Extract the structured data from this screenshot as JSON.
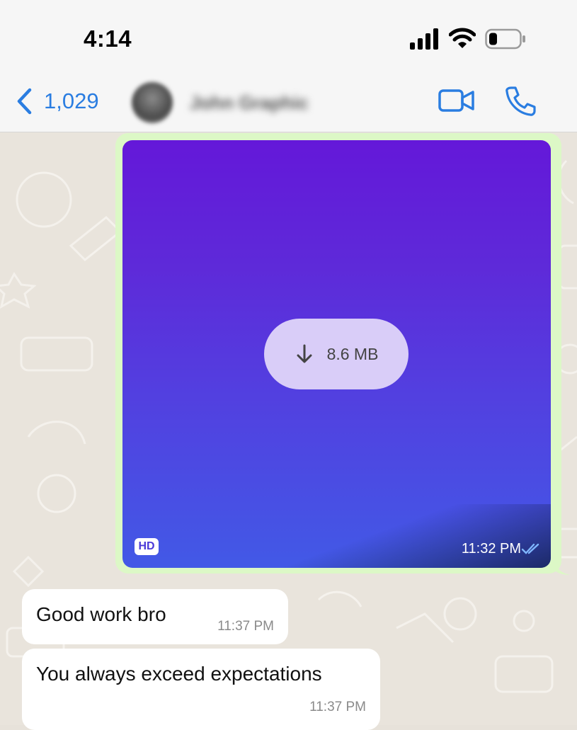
{
  "status_bar": {
    "time": "4:14"
  },
  "header": {
    "back_count": "1,029",
    "contact_name": "John Graphic"
  },
  "messages": {
    "image": {
      "download_size": "8.6 MB",
      "hd_label": "HD",
      "time": "11:32 PM"
    },
    "text": [
      {
        "text": "Good work bro",
        "time": "11:37 PM"
      },
      {
        "text": "You always exceed expectations",
        "time": "11:37 PM"
      }
    ]
  },
  "colors": {
    "accent": "#2a7de1",
    "outgoing_bubble": "#dcf8c6",
    "incoming_bubble": "#ffffff",
    "chat_background": "#e9e4dc",
    "read_ticks": "#4fa3ff"
  }
}
